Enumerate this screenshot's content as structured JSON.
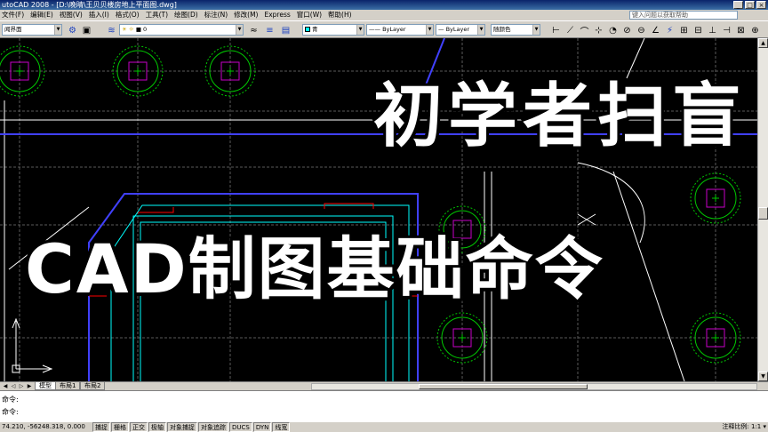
{
  "window": {
    "title": "utoCAD 2008 - [D:\\晚晴\\王贝贝楼房地上平面图.dwg]",
    "controls": [
      "_",
      "□",
      "×"
    ]
  },
  "menubar": {
    "items": [
      "文件(F)",
      "编辑(E)",
      "视图(V)",
      "插入(I)",
      "格式(O)",
      "工具(T)",
      "绘图(D)",
      "标注(N)",
      "修改(M)",
      "Express",
      "窗口(W)",
      "帮助(H)"
    ],
    "help_search_placeholder": "键入问题以获取帮助"
  },
  "toolbar": {
    "workspace": "闻界面",
    "layer_value": "0",
    "color_value": "青",
    "linetype_value": "ByLayer",
    "lineweight_value": "ByLayer",
    "plotstyle_value": "随颜色"
  },
  "overlay": {
    "line1": "初学者扫盲",
    "line2": "CAD制图基础命令"
  },
  "tabs": {
    "items": [
      "模型",
      "布局1",
      "布局2"
    ],
    "active": "模型"
  },
  "command": {
    "line1": "命令:",
    "line2": "命令:"
  },
  "status": {
    "coords": "74.210, -56248.318, 0.000",
    "toggles": [
      "捕捉",
      "栅格",
      "正交",
      "极轴",
      "对象捕捉",
      "对象追踪",
      "DUCS",
      "DYN",
      "线宽"
    ],
    "annotation_scale": "注释比例: 1:1 ▾"
  },
  "colors": {
    "canvas": "#000000",
    "column_circle": "#00c800",
    "column_square": "#c800c8",
    "wall_cyan": "#00ffff",
    "wall_blue": "#4040ff",
    "wall_red": "#ff0000",
    "axis": "#ffffff"
  }
}
